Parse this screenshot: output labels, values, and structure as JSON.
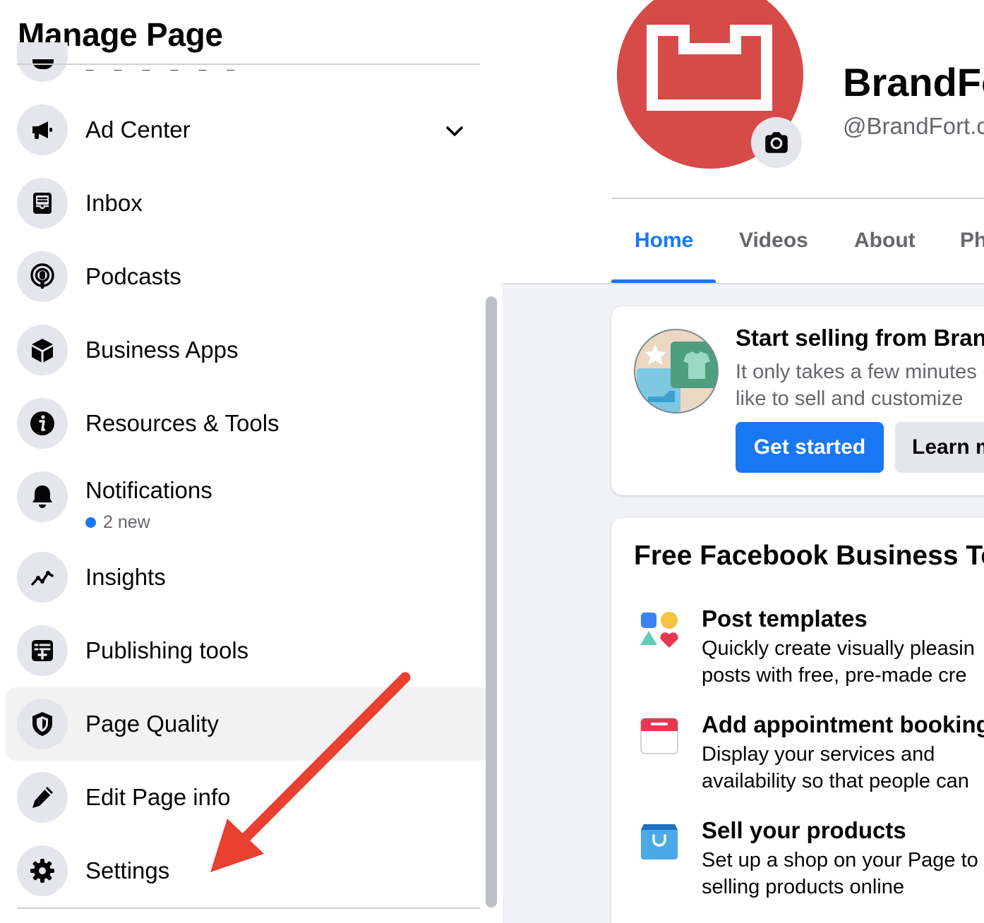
{
  "sidebar": {
    "title": "Manage Page",
    "items": [
      {
        "label": "Ad Center",
        "icon": "megaphone-icon",
        "expandable": true
      },
      {
        "label": "Inbox",
        "icon": "inbox-icon"
      },
      {
        "label": "Podcasts",
        "icon": "podcast-icon"
      },
      {
        "label": "Business Apps",
        "icon": "cube-icon"
      },
      {
        "label": "Resources & Tools",
        "icon": "info-icon"
      },
      {
        "label": "Notifications",
        "icon": "bell-icon",
        "sub": "2 new"
      },
      {
        "label": "Insights",
        "icon": "line-chart-icon"
      },
      {
        "label": "Publishing tools",
        "icon": "publishing-icon"
      },
      {
        "label": "Page Quality",
        "icon": "shield-icon",
        "active": true
      },
      {
        "label": "Edit Page info",
        "icon": "pencil-icon"
      },
      {
        "label": "Settings",
        "icon": "gear-icon"
      }
    ]
  },
  "page": {
    "name": "BrandFo",
    "handle": "@BrandFort.c",
    "tabs": [
      "Home",
      "Videos",
      "About",
      "Ph"
    ],
    "active_tab": "Home"
  },
  "shop_card": {
    "title": "Start selling from Bran",
    "desc_line1": "It only takes a few minutes",
    "desc_line2": "like to sell and customize",
    "primary_button": "Get started",
    "secondary_button": "Learn m"
  },
  "tools_card": {
    "title": "Free Facebook Business To",
    "tools": [
      {
        "title": "Post templates",
        "line1": "Quickly create visually pleasin",
        "line2": "posts with free, pre-made cre",
        "icon": "shapes-icon"
      },
      {
        "title": "Add appointment booking",
        "line1": "Display your services and",
        "line2": "availability so that people can",
        "icon": "calendar-icon"
      },
      {
        "title": "Sell your products",
        "line1": "Set up a shop on your Page to",
        "line2": "selling products online",
        "icon": "shopping-bag-icon"
      }
    ]
  },
  "colors": {
    "accent": "#1877f2",
    "avatar_bg": "#d64a48",
    "annotation_arrow": "#e9402f",
    "text_secondary": "#65676b"
  }
}
